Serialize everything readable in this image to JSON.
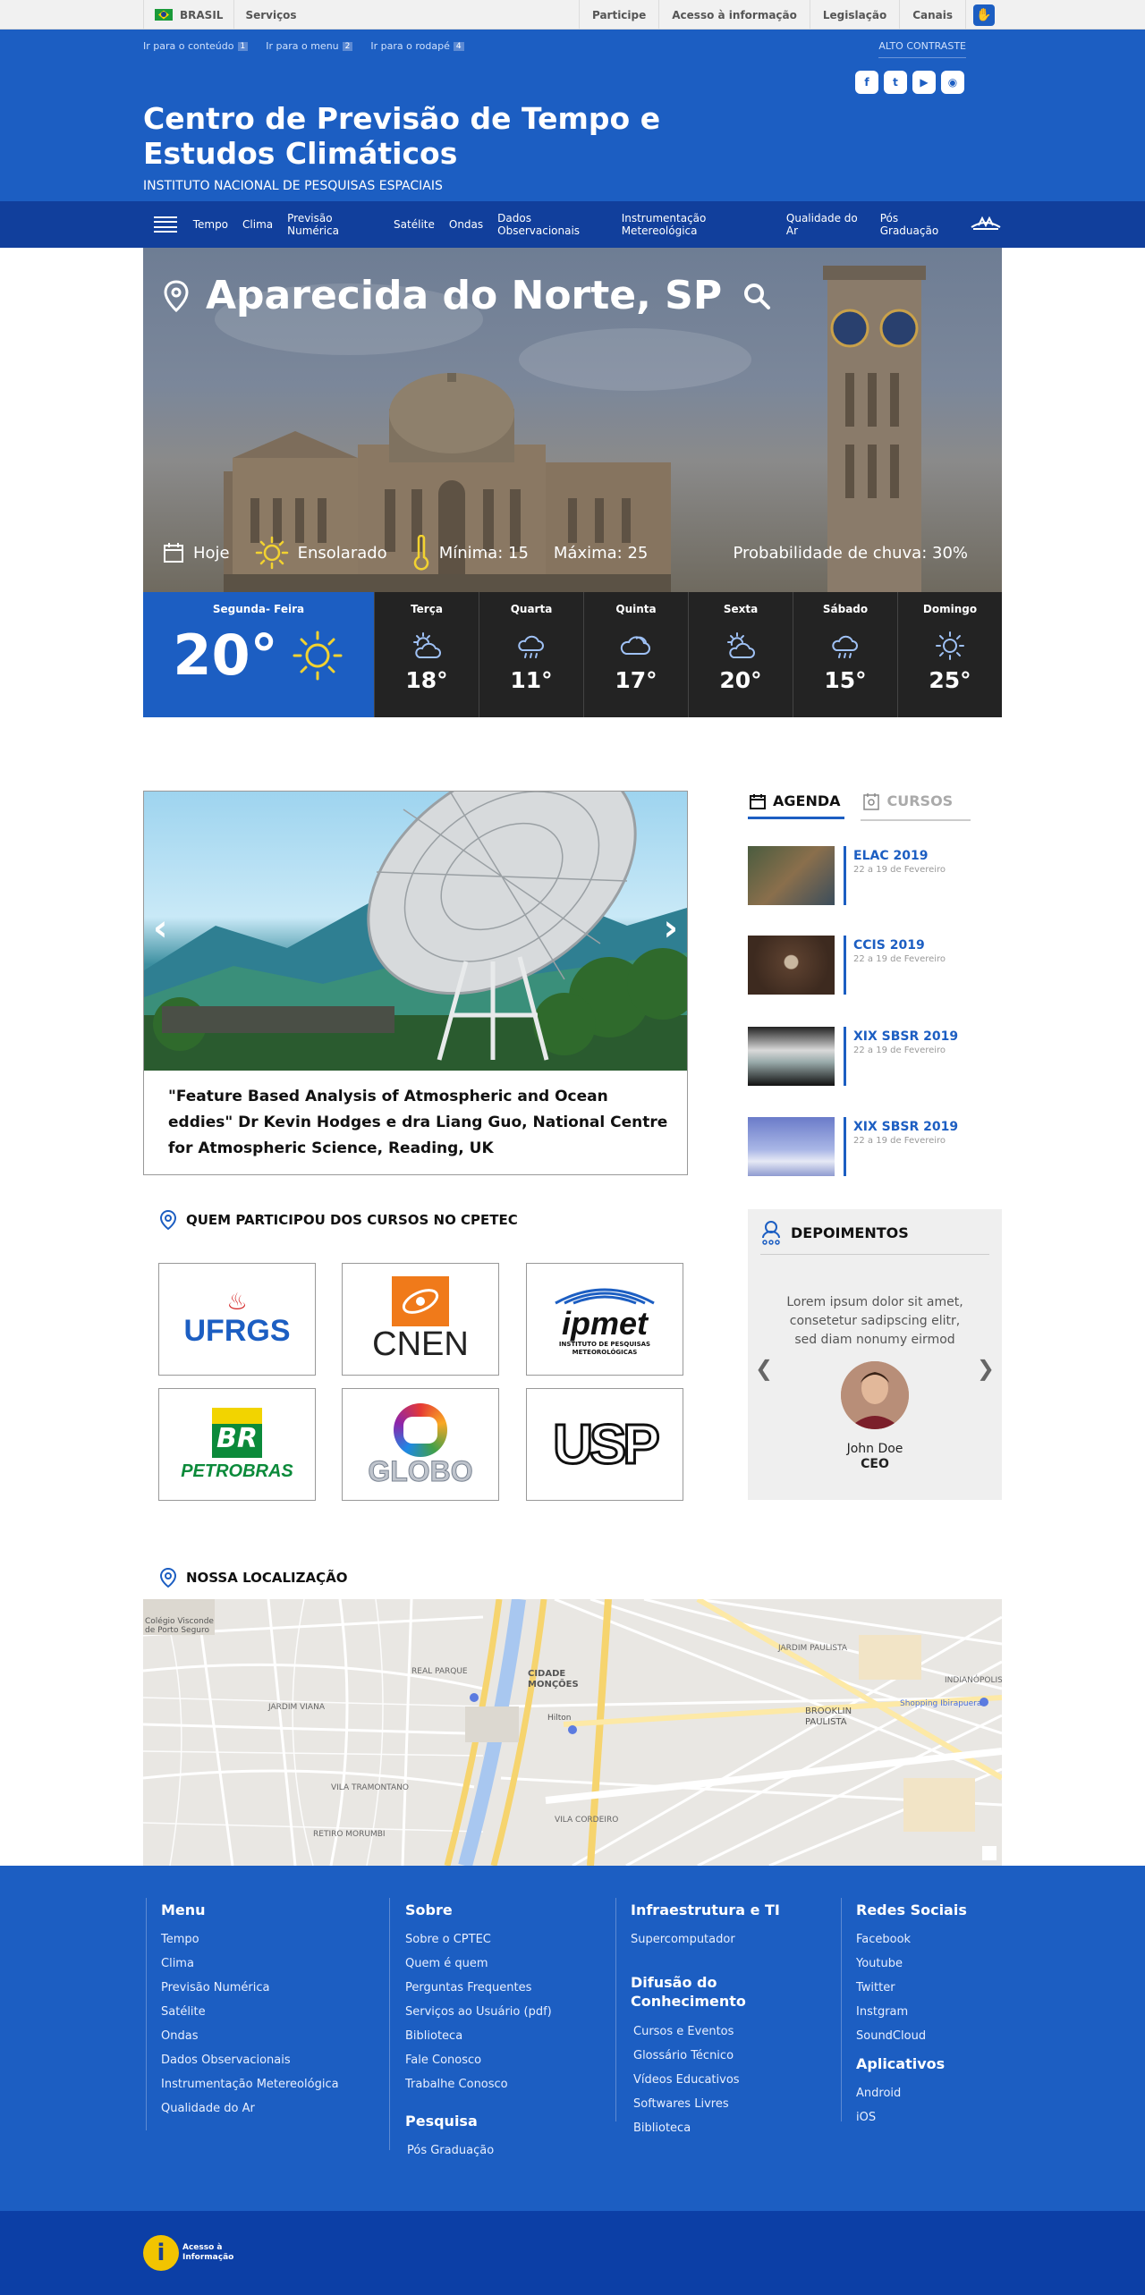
{
  "govbar": {
    "brasil": "BRASIL",
    "servicos": "Serviços",
    "links": [
      "Participe",
      "Acesso à informação",
      "Legislação",
      "Canais"
    ]
  },
  "header": {
    "skip_links": [
      {
        "label": "Ir para o conteúdo",
        "key": "1"
      },
      {
        "label": "Ir para o menu",
        "key": "2"
      },
      {
        "label": "Ir para o rodapé",
        "key": "4"
      }
    ],
    "contrast": "ALTO CONTRASTE",
    "title": "Centro de Previsão de Tempo e Estudos Climáticos",
    "subtitle": "INSTITUTO NACIONAL DE PESQUISAS ESPACIAIS",
    "socials": [
      "facebook-icon",
      "twitter-icon",
      "youtube-icon",
      "rss-icon"
    ]
  },
  "menu": {
    "items": [
      "Tempo",
      "Clima",
      "Previsão Numérica",
      "Satélite",
      "Ondas",
      "Dados Observacionais",
      "Instrumentação Metereológica",
      "Qualidade do Ar",
      "Pós Graduação"
    ]
  },
  "hero": {
    "location": "Aparecida do Norte, SP",
    "day": "Hoje",
    "condition": "Ensolarado",
    "min": "Mínima: 15",
    "max": "Máxima: 25",
    "rain": "Probabilidade de chuva: 30%"
  },
  "forecast": {
    "today": {
      "day": "Segunda- Feira",
      "temp": "20°",
      "icon": "sun-icon"
    },
    "days": [
      {
        "day": "Terça",
        "temp": "18°",
        "icon": "partly-cloudy-icon"
      },
      {
        "day": "Quarta",
        "temp": "11°",
        "icon": "rain-icon"
      },
      {
        "day": "Quinta",
        "temp": "17°",
        "icon": "cloud-icon"
      },
      {
        "day": "Sexta",
        "temp": "20°",
        "icon": "partly-cloudy-icon"
      },
      {
        "day": "Sábado",
        "temp": "15°",
        "icon": "rain-icon"
      },
      {
        "day": "Domingo",
        "temp": "25°",
        "icon": "sun-icon"
      }
    ]
  },
  "news": {
    "caption": "\"Feature Based Analysis of Atmospheric and Ocean eddies\" Dr Kevin Hodges e dra Liang Guo, National Centre for Atmospheric  Science, Reading, UK",
    "prev": "‹",
    "next": "›"
  },
  "agenda": {
    "tab_agenda": "AGENDA",
    "tab_cursos": "CURSOS",
    "events": [
      {
        "title": "ELAC 2019",
        "date": "22 a 19 de  Fevereiro"
      },
      {
        "title": "CCIS 2019",
        "date": "22 a 19 de  Fevereiro"
      },
      {
        "title": "XIX SBSR 2019",
        "date": "22 a 19 de  Fevereiro"
      },
      {
        "title": "XIX SBSR 2019",
        "date": "22 a 19 de  Fevereiro"
      }
    ]
  },
  "partners": {
    "title": "QUEM PARTICIPOU DOS CURSOS NO CPETEC",
    "logos": [
      "UFRGS",
      "CNEN",
      "ipmet",
      "INSTITUTO DE PESQUISAS METEOROLÓGICAS",
      "BR",
      "PETROBRAS",
      "GLOBO",
      "USP"
    ]
  },
  "depo": {
    "title": "DEPOIMENTOS",
    "text": "Lorem ipsum dolor sit amet, consetetur sadipscing elitr, sed diam nonumy eirmod",
    "name": "John Doe",
    "role": "CEO"
  },
  "location": {
    "title": "NOSSA LOCALIZAÇÃO",
    "map_labels": [
      "Colégio Visconde de Porto Seguro",
      "REAL PARQUE",
      "JARDIM VIANA",
      "VILA TRAMONTANO",
      "RETIRO MORUMBI",
      "CIDADE MONÇÕES",
      "Hilton",
      "VILA CORDEIRO",
      "JARDIM PAULISTA",
      "BROOKLIN PAULISTA",
      "Shopping Ibirapuera",
      "INDIANÓPOLIS"
    ]
  },
  "footer": {
    "menu": {
      "title": "Menu",
      "items": [
        "Tempo",
        "Clima",
        "Previsão Numérica",
        "Satélite",
        "Ondas",
        "Dados Observacionais",
        "Instrumentação Metereológica",
        "Qualidade do Ar"
      ]
    },
    "sobre": {
      "title": "Sobre",
      "items": [
        "Sobre o CPTEC",
        "Quem é quem",
        "Perguntas Frequentes",
        "Serviços ao Usuário (pdf)",
        "Biblioteca",
        "Fale Conosco",
        "Trabalhe Conosco"
      ]
    },
    "pesquisa": {
      "title": "Pesquisa",
      "items": [
        "Pós Graduação"
      ]
    },
    "infra": {
      "title": "Infraestrutura e TI",
      "items": [
        "Supercomputador"
      ]
    },
    "difusao": {
      "title": "Difusão do Conhecimento",
      "items": [
        "Cursos e Eventos",
        "Glossário Técnico",
        "Vídeos Educativos",
        "Softwares Livres",
        "Biblioteca"
      ]
    },
    "redes": {
      "title": "Redes Sociais",
      "items": [
        "Facebook",
        "Youtube",
        "Twitter",
        "Instgram",
        "SoundCloud"
      ]
    },
    "apps": {
      "title": "Aplicativos",
      "items": [
        "Android",
        "iOS"
      ]
    },
    "acesso": "Acesso à Informação"
  },
  "colors": {
    "primary": "#1c5ec2",
    "menu": "#113f9c",
    "bottom": "#0c3fa6",
    "dark": "#232323"
  }
}
